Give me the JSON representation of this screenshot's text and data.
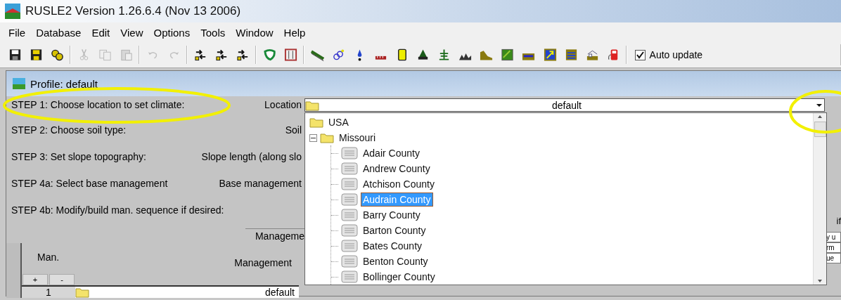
{
  "window": {
    "title": "RUSLE2 Version 1.26.6.4 (Nov 13 2006)"
  },
  "menu": [
    "File",
    "Database",
    "Edit",
    "View",
    "Options",
    "Tools",
    "Window",
    "Help"
  ],
  "toolbar": [
    {
      "kind": "save",
      "disabled": false
    },
    {
      "kind": "save-all",
      "disabled": false
    },
    {
      "kind": "link",
      "disabled": false
    },
    {
      "kind": "separator"
    },
    {
      "kind": "cut",
      "disabled": true
    },
    {
      "kind": "copy",
      "disabled": true
    },
    {
      "kind": "paste",
      "disabled": true
    },
    {
      "kind": "separator"
    },
    {
      "kind": "undo",
      "disabled": true
    },
    {
      "kind": "redo",
      "disabled": true
    },
    {
      "kind": "separator"
    },
    {
      "kind": "swap",
      "disabled": false
    },
    {
      "kind": "swap",
      "disabled": false
    },
    {
      "kind": "swap",
      "disabled": false
    },
    {
      "kind": "separator"
    },
    {
      "kind": "shape",
      "disabled": false
    },
    {
      "kind": "book",
      "disabled": false
    },
    {
      "kind": "separator"
    },
    {
      "kind": "slope",
      "disabled": false
    },
    {
      "kind": "blobs",
      "disabled": false
    },
    {
      "kind": "drop",
      "disabled": false
    },
    {
      "kind": "ruler",
      "disabled": false
    },
    {
      "kind": "page",
      "disabled": false
    },
    {
      "kind": "plant",
      "disabled": false
    },
    {
      "kind": "tree",
      "disabled": false
    },
    {
      "kind": "terrain",
      "disabled": false
    },
    {
      "kind": "hill",
      "disabled": false
    },
    {
      "kind": "field",
      "disabled": false
    },
    {
      "kind": "water",
      "disabled": false
    },
    {
      "kind": "arrow",
      "disabled": false
    },
    {
      "kind": "layers",
      "disabled": false
    },
    {
      "kind": "barn",
      "disabled": false
    },
    {
      "kind": "pump",
      "disabled": false
    },
    {
      "kind": "separator"
    }
  ],
  "auto_update": {
    "label": "Auto update",
    "checked": true
  },
  "profile": {
    "title": "Profile:  default",
    "steps": [
      {
        "label": "STEP 1: Choose location to set climate:",
        "field_label": "Location"
      },
      {
        "label": "STEP 2: Choose soil type:",
        "field_label": "Soil"
      },
      {
        "label": "STEP 3: Set slope topography:",
        "field_label": "Slope length (along slo"
      },
      {
        "label": "STEP 4a: Select base management",
        "field_label": "Base management"
      },
      {
        "label": "STEP 4b: Modify/build man. sequence if desired:"
      }
    ],
    "location": {
      "value": "default",
      "open": true
    },
    "tree": [
      {
        "label": "USA",
        "selected": false,
        "children": [
          {
            "label": "Missouri",
            "expanded": true,
            "selected": false,
            "children": [
              {
                "label": "Adair County",
                "selected": false
              },
              {
                "label": "Andrew County",
                "selected": false
              },
              {
                "label": "Atchison County",
                "selected": false
              },
              {
                "label": "Audrain County",
                "selected": true
              },
              {
                "label": "Barry County",
                "selected": false
              },
              {
                "label": "Barton County",
                "selected": false
              },
              {
                "label": "Bates County",
                "selected": false
              },
              {
                "label": "Benton County",
                "selected": false
              },
              {
                "label": "Bollinger County",
                "selected": false
              }
            ]
          }
        ]
      }
    ],
    "management_label": "Manageme",
    "table": {
      "columns": [
        "Man.",
        "Management"
      ],
      "add": "+",
      "remove": "-",
      "rows": [
        {
          "number": "1",
          "management": "default"
        }
      ]
    },
    "right_text": "if",
    "right_fragments": [
      "y u",
      "rm",
      "ue"
    ]
  },
  "annotations": [
    {
      "kind": "ellipse"
    },
    {
      "kind": "ellipse"
    }
  ]
}
